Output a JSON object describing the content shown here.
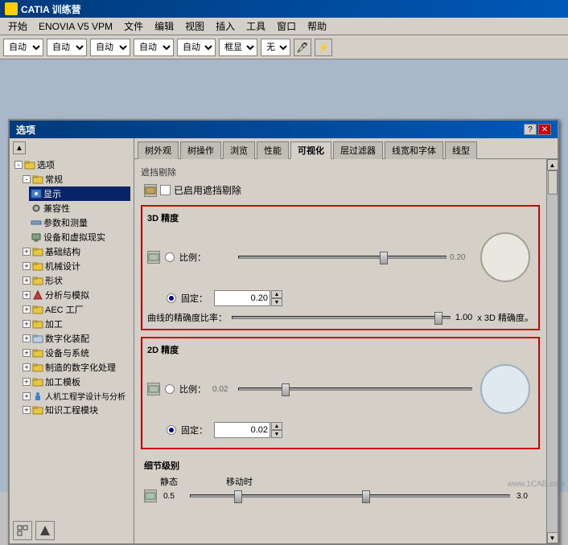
{
  "titlebar": {
    "title": "CATIA 训练营"
  },
  "menubar": {
    "items": [
      "开始",
      "ENOVIA V5 VPM",
      "文件",
      "编辑",
      "视图",
      "插入",
      "工具",
      "窗口",
      "帮助"
    ]
  },
  "toolbar": {
    "selects": [
      {
        "value": "自动",
        "options": [
          "自动"
        ]
      },
      {
        "value": "自动",
        "options": [
          "自动"
        ]
      },
      {
        "value": "自动",
        "options": [
          "自动"
        ]
      },
      {
        "value": "自动",
        "options": [
          "自动"
        ]
      },
      {
        "value": "自动",
        "options": [
          "自动"
        ]
      },
      {
        "value": "框显",
        "options": [
          "框显"
        ]
      },
      {
        "value": "无",
        "options": [
          "无"
        ]
      }
    ]
  },
  "dialog": {
    "title": "选项",
    "help_btn": "?",
    "close_btn": "✕"
  },
  "tree": {
    "items": [
      {
        "id": "root",
        "label": "选项",
        "indent": 0,
        "expanded": true,
        "icon": "folder"
      },
      {
        "id": "general",
        "label": "常规",
        "indent": 1,
        "expanded": true,
        "icon": "folder"
      },
      {
        "id": "display",
        "label": "显示",
        "indent": 2,
        "selected": true,
        "highlighted": true,
        "icon": "eye"
      },
      {
        "id": "compat",
        "label": "兼容性",
        "indent": 2,
        "icon": "gear"
      },
      {
        "id": "measure",
        "label": "参数和测量",
        "indent": 2,
        "icon": "ruler"
      },
      {
        "id": "devices",
        "label": "设备和虚拟现实",
        "indent": 2,
        "icon": "device"
      },
      {
        "id": "infra",
        "label": "基础结构",
        "indent": 1,
        "icon": "folder"
      },
      {
        "id": "mechdesign",
        "label": "机械设计",
        "indent": 1,
        "icon": "folder"
      },
      {
        "id": "shape",
        "label": "形状",
        "indent": 1,
        "icon": "folder"
      },
      {
        "id": "analysis",
        "label": "分析与模拟",
        "indent": 1,
        "icon": "folder"
      },
      {
        "id": "aec",
        "label": "AEC 工厂",
        "indent": 1,
        "icon": "folder"
      },
      {
        "id": "machining",
        "label": "加工",
        "indent": 1,
        "icon": "folder"
      },
      {
        "id": "digital",
        "label": "数字化装配",
        "indent": 1,
        "icon": "folder"
      },
      {
        "id": "systems",
        "label": "设备与系统",
        "indent": 1,
        "icon": "folder"
      },
      {
        "id": "mfgdigital",
        "label": "制造的数字化处理",
        "indent": 1,
        "icon": "folder"
      },
      {
        "id": "machtemp",
        "label": "加工模板",
        "indent": 1,
        "icon": "folder"
      },
      {
        "id": "ergon",
        "label": "人机工程学设计与分析",
        "indent": 1,
        "icon": "folder"
      },
      {
        "id": "knowledge",
        "label": "知识工程模块",
        "indent": 1,
        "icon": "folder"
      }
    ]
  },
  "tabs": {
    "items": [
      "树外观",
      "树操作",
      "浏览",
      "性能",
      "可视化",
      "层过滤器",
      "线宽和字体",
      "线型"
    ],
    "active": "可视化"
  },
  "content": {
    "occlusion": {
      "title": "遮挡剔除",
      "checkbox_label": "已启用遮挡剔除"
    },
    "precision_3d": {
      "title": "3D 精度",
      "ratio_label": "比例：",
      "ratio_value": "0.20",
      "fixed_label": "固定：",
      "fixed_value": "0.20",
      "curve_label": "曲线的精确度比率：",
      "curve_value": "1.00",
      "curve_suffix": "x 3D 精确度。",
      "slider_ratio_pct": 70,
      "slider_fixed_pct": 70,
      "slider_curve_pct": 95
    },
    "precision_2d": {
      "title": "2D 精度",
      "ratio_label": "比例：",
      "ratio_value": "0.02",
      "fixed_label": "固定：",
      "fixed_value": "0.02",
      "slider_ratio_pct": 20,
      "slider_fixed_pct": 20
    },
    "detail": {
      "title": "细节级别",
      "static_label": "静态",
      "moving_label": "移动时",
      "static_value": "0.5",
      "moving_value": "3.0",
      "slider_static_pct": 15,
      "slider_moving_pct": 55
    }
  },
  "watermark": {
    "text": "www.1CAE.com"
  }
}
